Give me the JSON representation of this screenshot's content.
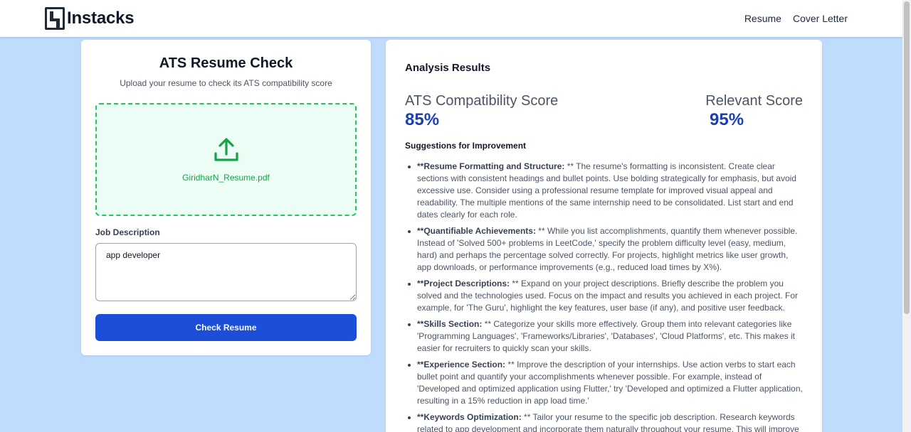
{
  "brand": {
    "name": "Instacks"
  },
  "nav": {
    "links": [
      "Resume",
      "Cover Letter"
    ]
  },
  "left": {
    "title": "ATS Resume Check",
    "subtitle": "Upload your resume to check its ATS compatibility score",
    "upload": {
      "file_name": "GiridharN_Resume.pdf"
    },
    "job_description": {
      "label": "Job Description",
      "value": "app developer"
    },
    "check_button": "Check Resume"
  },
  "right": {
    "title": "Analysis Results",
    "ats_label": "ATS Compatibility Score",
    "ats_value": "85%",
    "relevant_label": "Relevant Score",
    "relevant_value": "95%",
    "suggestions_title": "Suggestions for Improvement",
    "suggestions": [
      {
        "head": "**Resume Formatting and Structure:",
        "body": " ** The resume's formatting is inconsistent. Create clear sections with consistent headings and bullet points. Use bolding strategically for emphasis, but avoid excessive use. Consider using a professional resume template for improved visual appeal and readability. The multiple mentions of the same internship need to be consolidated. List start and end dates clearly for each role."
      },
      {
        "head": "**Quantifiable Achievements:",
        "body": " ** While you list accomplishments, quantify them whenever possible. Instead of 'Solved 500+ problems in LeetCode,' specify the problem difficulty level (easy, medium, hard) and perhaps the percentage solved correctly. For projects, highlight metrics like user growth, app downloads, or performance improvements (e.g., reduced load times by X%)."
      },
      {
        "head": "**Project Descriptions:",
        "body": " ** Expand on your project descriptions. Briefly describe the problem you solved and the technologies used. Focus on the impact and results you achieved in each project. For example, for 'The Guru', highlight the key features, user base (if any), and positive user feedback."
      },
      {
        "head": "**Skills Section:",
        "body": " ** Categorize your skills more effectively. Group them into relevant categories like 'Programming Languages', 'Frameworks/Libraries', 'Databases', 'Cloud Platforms', etc. This makes it easier for recruiters to quickly scan your skills."
      },
      {
        "head": "**Experience Section:",
        "body": " ** Improve the description of your internships. Use action verbs to start each bullet point and quantify your accomplishments whenever possible. For example, instead of 'Developed and optimized application using Flutter,' try 'Developed and optimized a Flutter application, resulting in a 15% reduction in app load time.'"
      },
      {
        "head": "**Keywords Optimization:",
        "body": " ** Tailor your resume to the specific job description. Research keywords related to app development and incorporate them naturally throughout your resume. This will improve"
      }
    ]
  },
  "colors": {
    "page_bg": "#bfdbfe",
    "accent": "#1d4ed8",
    "score": "#1e40af",
    "upload_border": "#22c55e"
  }
}
